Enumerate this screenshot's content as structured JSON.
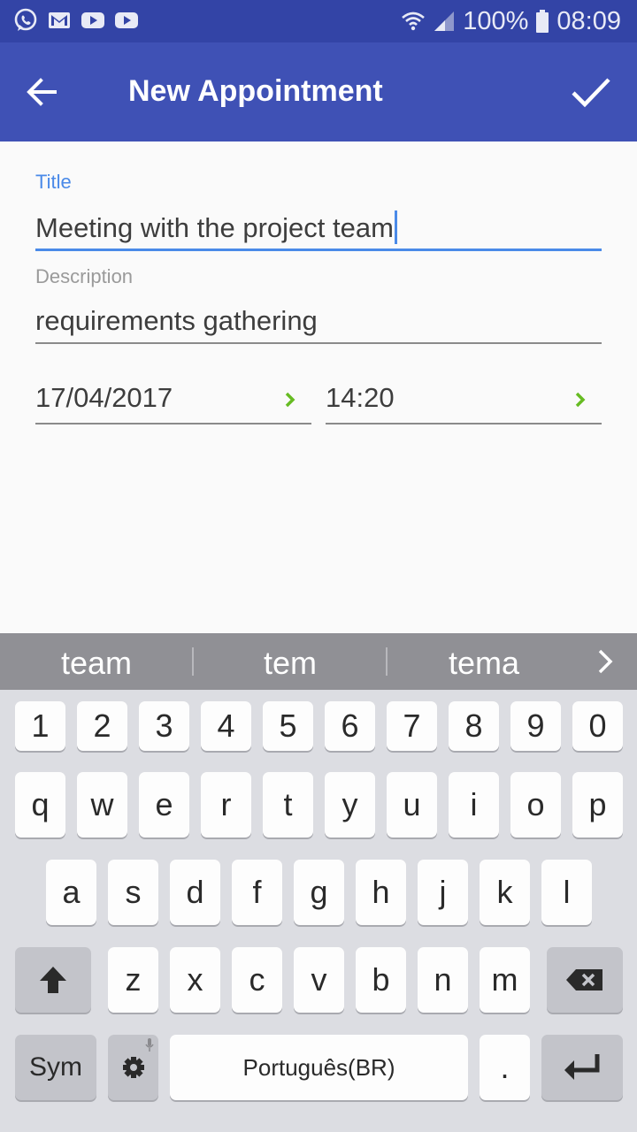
{
  "status_bar": {
    "battery": "100%",
    "time": "08:09",
    "icons_left": [
      "whatsapp-icon",
      "gmail-icon",
      "youtube-icon",
      "youtube-icon"
    ],
    "icons_right": [
      "wifi-icon",
      "signal-icon",
      "battery-icon"
    ]
  },
  "app_bar": {
    "title": "New Appointment",
    "back_icon": "arrow-back-icon",
    "confirm_icon": "check-icon",
    "color": "#3f51b5"
  },
  "form": {
    "title_label": "Title",
    "title_value": "Meeting with the project team",
    "description_label": "Description",
    "description_value": "requirements gathering",
    "date_value": "17/04/2017",
    "time_value": "14:20",
    "accent_color": "#4a8ae8",
    "chevron_color": "#66bb22"
  },
  "suggestions": {
    "words": [
      "team",
      "tem",
      "tema"
    ],
    "more_icon": "chevron-right-icon"
  },
  "keyboard": {
    "row_numbers": [
      "1",
      "2",
      "3",
      "4",
      "5",
      "6",
      "7",
      "8",
      "9",
      "0"
    ],
    "row_1": [
      "q",
      "w",
      "e",
      "r",
      "t",
      "y",
      "u",
      "i",
      "o",
      "p"
    ],
    "row_2": [
      "a",
      "s",
      "d",
      "f",
      "g",
      "h",
      "j",
      "k",
      "l"
    ],
    "row_3": [
      "z",
      "x",
      "c",
      "v",
      "b",
      "n",
      "m"
    ],
    "sym_label": "Sym",
    "space_label": "Português(BR)",
    "period_label": "."
  }
}
